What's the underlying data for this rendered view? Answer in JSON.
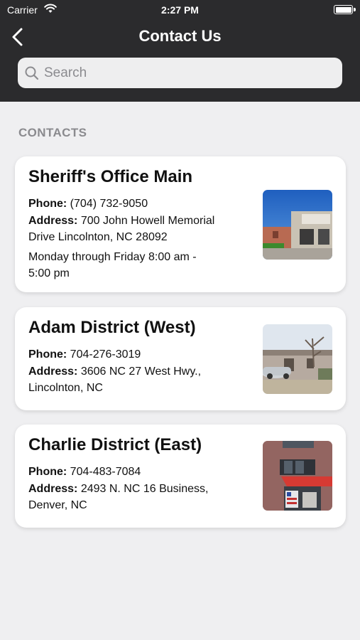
{
  "status_bar": {
    "carrier": "Carrier",
    "time": "2:27 PM"
  },
  "nav": {
    "title": "Contact Us"
  },
  "search": {
    "placeholder": "Search"
  },
  "section_header": "CONTACTS",
  "contacts": [
    {
      "name": "Sheriff's Office Main",
      "phone_label": "Phone:",
      "phone": "(704) 732-9050",
      "address_label": "Address:",
      "address_line1": "700 John Howell Memorial",
      "address_line2": "Drive Lincolnton, NC 28092",
      "hours_line1": "Monday through Friday 8:00 am -",
      "hours_line2": "5:00 pm"
    },
    {
      "name": "Adam District (West)",
      "phone_label": "Phone:",
      "phone": "704-276-3019",
      "address_label": "Address:",
      "address_line1": "3606 NC 27 West Hwy.,",
      "address_line2": "Lincolnton, NC"
    },
    {
      "name": "Charlie District (East)",
      "phone_label": "Phone:",
      "phone": "704-483-7084",
      "address_label": "Address:",
      "address_line1": "2493 N. NC 16 Business,",
      "address_line2": "Denver, NC"
    }
  ],
  "colors": {
    "header_bg": "#2b2b2d",
    "page_bg": "#efeff1",
    "card_bg": "#ffffff",
    "section_text": "#8a8a8e"
  },
  "icons": {
    "back": "chevron-left-icon",
    "search": "magnifier-icon",
    "wifi": "wifi-icon",
    "battery": "battery-icon"
  }
}
